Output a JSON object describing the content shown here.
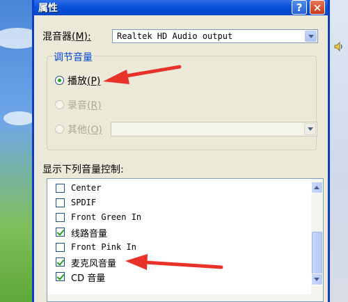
{
  "window": {
    "title": "属性",
    "help_label": "?",
    "close_label": "×"
  },
  "mixer": {
    "label": "混音器",
    "mnemonic": "(M):",
    "selected": "Realtek HD Audio output"
  },
  "adjust_group": {
    "title": "调节音量",
    "options": [
      {
        "label": "播放",
        "mnemonic": "(P)",
        "checked": true,
        "enabled": true
      },
      {
        "label": "录音",
        "mnemonic": "(R)",
        "checked": false,
        "enabled": false
      },
      {
        "label": "其他",
        "mnemonic": "(O)",
        "checked": false,
        "enabled": false
      }
    ]
  },
  "controls_label": "显示下列音量控制:",
  "controls": [
    {
      "label": "Center",
      "checked": false
    },
    {
      "label": "SPDIF",
      "checked": false
    },
    {
      "label": "Front Green In",
      "checked": false
    },
    {
      "label": "线路音量",
      "checked": true
    },
    {
      "label": "Front Pink In",
      "checked": false
    },
    {
      "label": "麦克风音量",
      "checked": true
    },
    {
      "label": "CD 音量",
      "checked": true
    }
  ],
  "colors": {
    "annotation_arrow": "#e8322a",
    "title_bar": "#0a53d9",
    "group_title": "#0046d5"
  }
}
